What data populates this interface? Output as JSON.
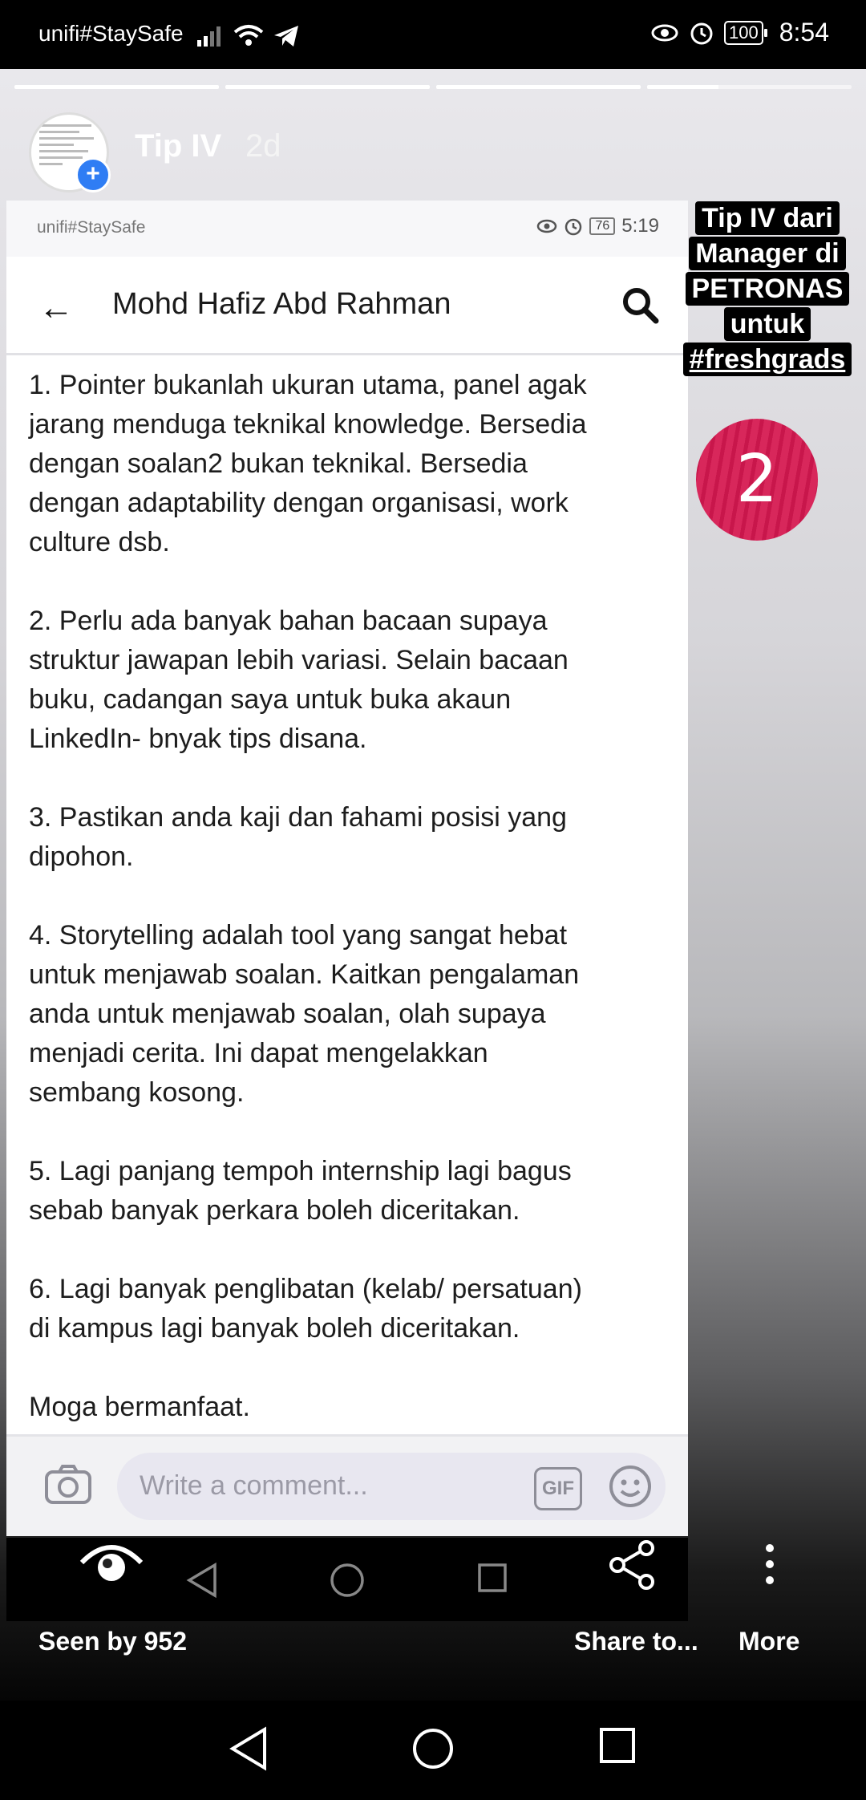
{
  "status_bar": {
    "carrier": "unifi#StaySafe",
    "battery": "100",
    "time": "8:54"
  },
  "story": {
    "username": "Tip IV",
    "age": "2d",
    "progress": {
      "segments": 4,
      "completed": 3,
      "current_fraction": 0.35
    }
  },
  "inner": {
    "status": {
      "carrier": "unifi#StaySafe",
      "battery": "76",
      "time": "5:19"
    },
    "title": "Mohd Hafiz Abd Rahman",
    "paragraphs": [
      "1. Pointer bukanlah ukuran utama, panel agak\njarang menduga teknikal knowledge. Bersedia\ndengan soalan2 bukan teknikal. Bersedia\ndengan adaptability dengan organisasi, work\nculture dsb.",
      "2. Perlu ada banyak bahan bacaan supaya\nstruktur jawapan lebih variasi. Selain bacaan\nbuku, cadangan saya untuk buka akaun\nLinkedIn- bnyak tips disana.",
      "3. Pastikan anda kaji dan fahami posisi yang\ndipohon.",
      "4. Storytelling adalah tool yang sangat hebat\nuntuk menjawab soalan. Kaitkan pengalaman\nanda untuk menjawab soalan, olah supaya\nmenjadi cerita. Ini dapat mengelakkan\nsembang kosong.",
      "5. Lagi panjang tempoh internship lagi bagus\nsebab banyak perkara boleh diceritakan.",
      "6. Lagi banyak penglibatan (kelab/ persatuan)\ndi kampus lagi banyak boleh diceritakan.",
      "Moga bermanfaat."
    ],
    "comment_placeholder": "Write a comment...",
    "gif_label": "GIF"
  },
  "sticker": {
    "lines": [
      "Tip IV dari",
      "Manager di",
      "PETRONAS",
      "untuk",
      "#freshgrads"
    ],
    "number": "2",
    "color": "#d8275b"
  },
  "actions": {
    "seen": "Seen by 952",
    "share": "Share to...",
    "more": "More"
  },
  "icons": [
    "eye-icon",
    "share-icon",
    "more-icon",
    "back-icon",
    "home-icon",
    "recents-icon",
    "camera-icon",
    "emoji-icon",
    "search-icon"
  ]
}
